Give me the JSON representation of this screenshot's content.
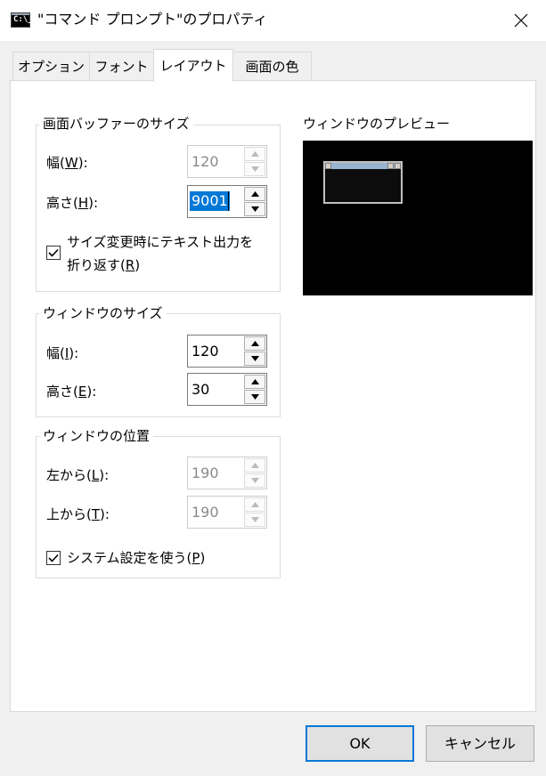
{
  "window": {
    "title": "\"コマンド プロンプト\"のプロパティ",
    "app_icon_text": "C:\\_",
    "app_icon": "console-icon",
    "close_icon": "close-icon"
  },
  "tabs": [
    {
      "label": "オプション",
      "active": false
    },
    {
      "label": "フォント",
      "active": false
    },
    {
      "label": "レイアウト",
      "active": true
    },
    {
      "label": "画面の色",
      "active": false
    }
  ],
  "screen_buffer": {
    "title": "画面バッファーのサイズ",
    "width_label": "幅(",
    "width_key": "W",
    "width_label_end": "):",
    "width_value": "120",
    "height_label": "高さ(",
    "height_key": "H",
    "height_label_end": "):",
    "height_value": "9001",
    "wrap_label_line1": "サイズ変更時にテキスト出力を",
    "wrap_label_line2": "折り返す(",
    "wrap_key": "R",
    "wrap_label_end": ")",
    "wrap_checked": true
  },
  "window_size": {
    "title": "ウィンドウのサイズ",
    "width_label": "幅(",
    "width_key": "I",
    "width_label_end": "):",
    "width_value": "120",
    "height_label": "高さ(",
    "height_key": "E",
    "height_label_end": "):",
    "height_value": "30"
  },
  "window_position": {
    "title": "ウィンドウの位置",
    "left_label": "左から(",
    "left_key": "L",
    "left_label_end": "):",
    "left_value": "190",
    "top_label": "上から(",
    "top_key": "T",
    "top_label_end": "):",
    "top_value": "190",
    "system_label": "システム設定を使う(",
    "system_key": "P",
    "system_label_end": ")",
    "system_checked": true
  },
  "preview": {
    "title": "ウィンドウのプレビュー"
  },
  "buttons": {
    "ok": "OK",
    "cancel": "キャンセル"
  },
  "colors": {
    "selection": "#0078d7",
    "default_button_border": "#0078d7"
  }
}
